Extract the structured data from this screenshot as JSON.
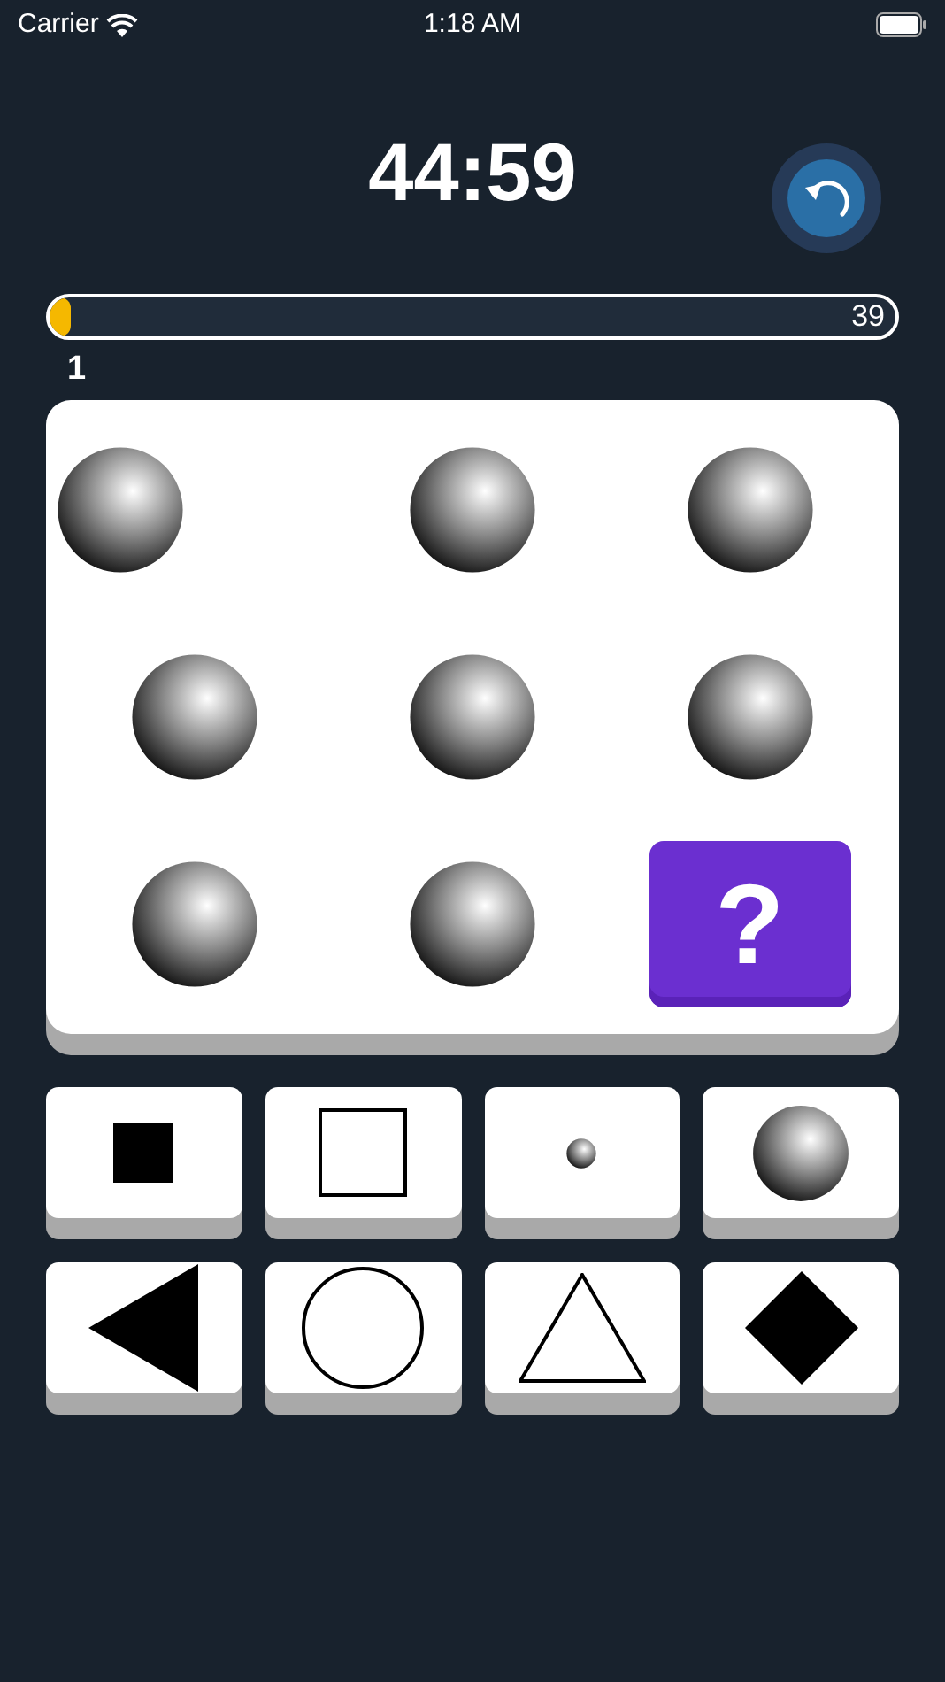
{
  "status_bar": {
    "carrier": "Carrier",
    "time": "1:18 AM"
  },
  "timer": "44:59",
  "progress": {
    "level": 0.026,
    "total": "39",
    "current": "1"
  },
  "puzzle": [
    {
      "kind": "sphere"
    },
    {
      "kind": "sphere"
    },
    {
      "kind": "sphere"
    },
    {
      "kind": "sphere"
    },
    {
      "kind": "sphere"
    },
    {
      "kind": "sphere"
    },
    {
      "kind": "sphere"
    },
    {
      "kind": "sphere"
    },
    {
      "kind": "question",
      "label": "?"
    }
  ],
  "answers": [
    {
      "kind": "filled-square"
    },
    {
      "kind": "outline-square"
    },
    {
      "kind": "small-sphere"
    },
    {
      "kind": "sphere"
    },
    {
      "kind": "filled-triangle-left"
    },
    {
      "kind": "outline-circle"
    },
    {
      "kind": "outline-triangle"
    },
    {
      "kind": "filled-diamond"
    }
  ]
}
